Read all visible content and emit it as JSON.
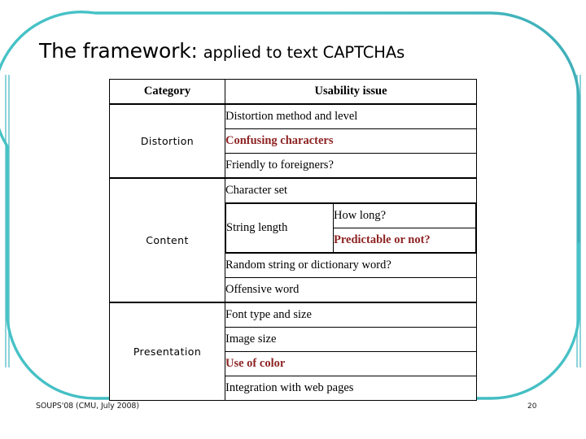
{
  "slide": {
    "title_main": "The framework:",
    "title_sub": "applied to text CAPTCHAs",
    "footer": "SOUPS'08 (CMU, July 2008)",
    "page_number": "20",
    "accent_color": "#46C2C6",
    "highlight_color": "#8E2323"
  },
  "table": {
    "headers": {
      "category": "Category",
      "usability_issue": "Usability issue"
    },
    "groups": [
      {
        "category": "Distortion",
        "issues": [
          {
            "text": "Distortion method and level",
            "highlighted": false
          },
          {
            "text": "Confusing characters",
            "highlighted": true
          },
          {
            "text": "Friendly to foreigners?",
            "highlighted": false
          }
        ]
      },
      {
        "category": "Content",
        "issues": [
          {
            "text": "Character set",
            "highlighted": false
          },
          {
            "text": "String length",
            "highlighted": false,
            "sub": [
              {
                "text": "How long?",
                "highlighted": false
              },
              {
                "text": "Predictable or not?",
                "highlighted": true
              }
            ]
          },
          {
            "text": "Random string or dictionary word?",
            "highlighted": false
          },
          {
            "text": "Offensive word",
            "highlighted": false
          }
        ]
      },
      {
        "category": "Presentation",
        "issues": [
          {
            "text": "Font type and size",
            "highlighted": false
          },
          {
            "text": "Image size",
            "highlighted": false
          },
          {
            "text": "Use of color",
            "highlighted": true
          },
          {
            "text": "Integration with web pages",
            "highlighted": false
          }
        ]
      }
    ]
  }
}
